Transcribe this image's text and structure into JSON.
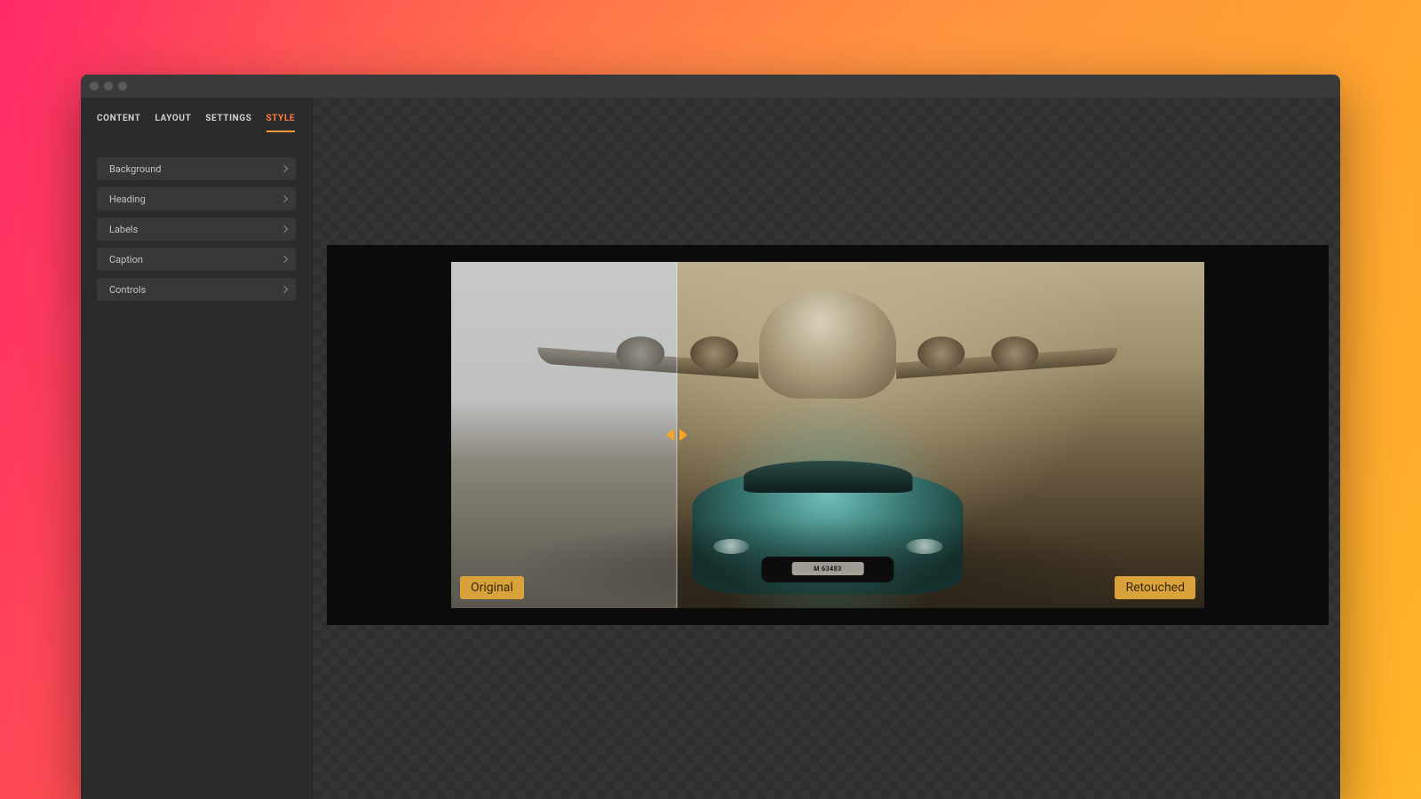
{
  "tabs": {
    "items": [
      {
        "label": "CONTENT",
        "active": false
      },
      {
        "label": "LAYOUT",
        "active": false
      },
      {
        "label": "SETTINGS",
        "active": false
      },
      {
        "label": "STYLE",
        "active": true
      }
    ]
  },
  "accordion": {
    "items": [
      {
        "label": "Background"
      },
      {
        "label": "Heading"
      },
      {
        "label": "Labels"
      },
      {
        "label": "Caption"
      },
      {
        "label": "Controls"
      }
    ]
  },
  "compare": {
    "left_label": "Original",
    "right_label": "Retouched",
    "divider_position_percent": 30,
    "plate_text": "M 63483"
  },
  "colors": {
    "accent": "#ff7a3c",
    "handle": "#f5a623",
    "tag_bg": "#d9a23a"
  }
}
